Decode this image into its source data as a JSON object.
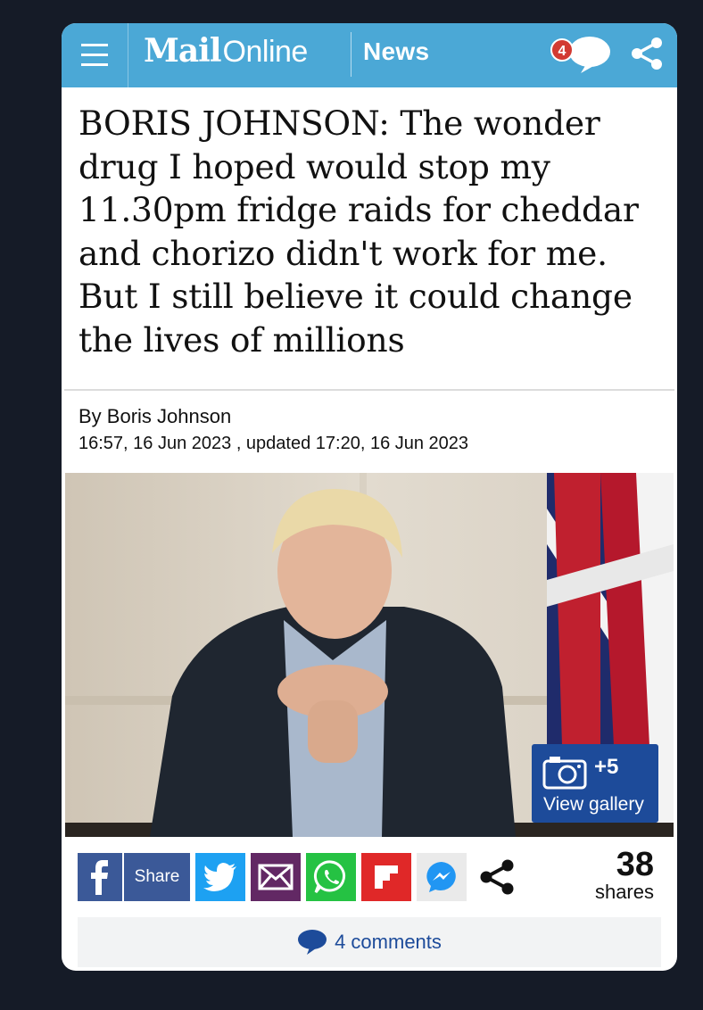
{
  "header": {
    "logo_mail": "Mail",
    "logo_online": "Online",
    "section": "News",
    "comment_count": "4",
    "background_color": "#4ba8d6"
  },
  "article": {
    "headline": "BORIS JOHNSON: The wonder drug I hoped would stop my 11.30pm fridge raids for cheddar and chorizo didn't work for me. But I still believe it could change the lives of millions",
    "byline": "By Boris Johnson",
    "dateline": "16:57, 16 Jun 2023 , updated 17:20, 16 Jun 2023"
  },
  "gallery": {
    "count": "+5",
    "label": "View gallery"
  },
  "share": {
    "share_label": "Share",
    "count": "38",
    "count_label": "shares",
    "icons": [
      "facebook-icon",
      "twitter-icon",
      "email-icon",
      "whatsapp-icon",
      "flipboard-icon",
      "messenger-icon",
      "share-icon"
    ]
  },
  "comments": {
    "label": "4 comments"
  }
}
